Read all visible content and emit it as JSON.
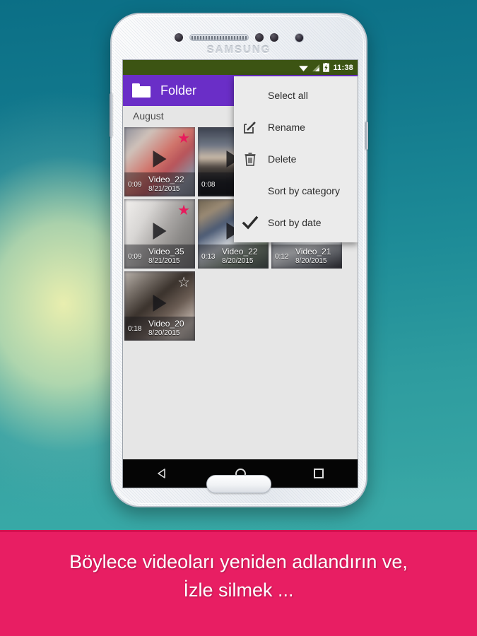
{
  "caption": {
    "line1": "Böylece videoları yeniden adlandırın ve,",
    "line2": "İzle silmek ..."
  },
  "phone": {
    "brand": "SAMSUNG"
  },
  "statusbar": {
    "time": "11:38",
    "icons": [
      "wifi-icon",
      "signal-icon",
      "battery-charging-icon"
    ]
  },
  "actionbar": {
    "icon": "folder-icon",
    "title": "Folder"
  },
  "section": {
    "header": "August"
  },
  "menu": {
    "items": [
      {
        "label": "Select all",
        "icon": "",
        "checked": false
      },
      {
        "label": "Rename",
        "icon": "rename-icon",
        "checked": false
      },
      {
        "label": "Delete",
        "icon": "trash-icon",
        "checked": false
      },
      {
        "label": "Sort by category",
        "icon": "",
        "checked": false
      },
      {
        "label": "Sort by date",
        "icon": "check-icon",
        "checked": true
      }
    ]
  },
  "videos": [
    {
      "name": "Video_22",
      "duration": "0:09",
      "date": "8/21/2015",
      "starred": true,
      "art": "a1"
    },
    {
      "name": "",
      "duration": "0:08",
      "date": "",
      "starred": false,
      "art": "a2"
    },
    {
      "name": "",
      "duration": "",
      "date": "",
      "starred": false,
      "art": "a3"
    },
    {
      "name": "Video_35",
      "duration": "0:09",
      "date": "8/21/2015",
      "starred": true,
      "art": "a3"
    },
    {
      "name": "Video_22",
      "duration": "0:13",
      "date": "8/20/2015",
      "starred": false,
      "art": "a4"
    },
    {
      "name": "Video_21",
      "duration": "0:12",
      "date": "8/20/2015",
      "starred": false,
      "art": "a5"
    },
    {
      "name": "Video_20",
      "duration": "0:18",
      "date": "8/20/2015",
      "starred": false,
      "art": "a6"
    }
  ],
  "navbar": {
    "back": "back-icon",
    "home": "home-icon",
    "recents": "recents-icon"
  },
  "colors": {
    "actionbar_purple": "#6a2ec7",
    "statusbar_green": "#3c5413",
    "caption_pink": "#e81e63",
    "star_pink": "#e81a5c",
    "screen_bg": "#e6e6e6"
  }
}
